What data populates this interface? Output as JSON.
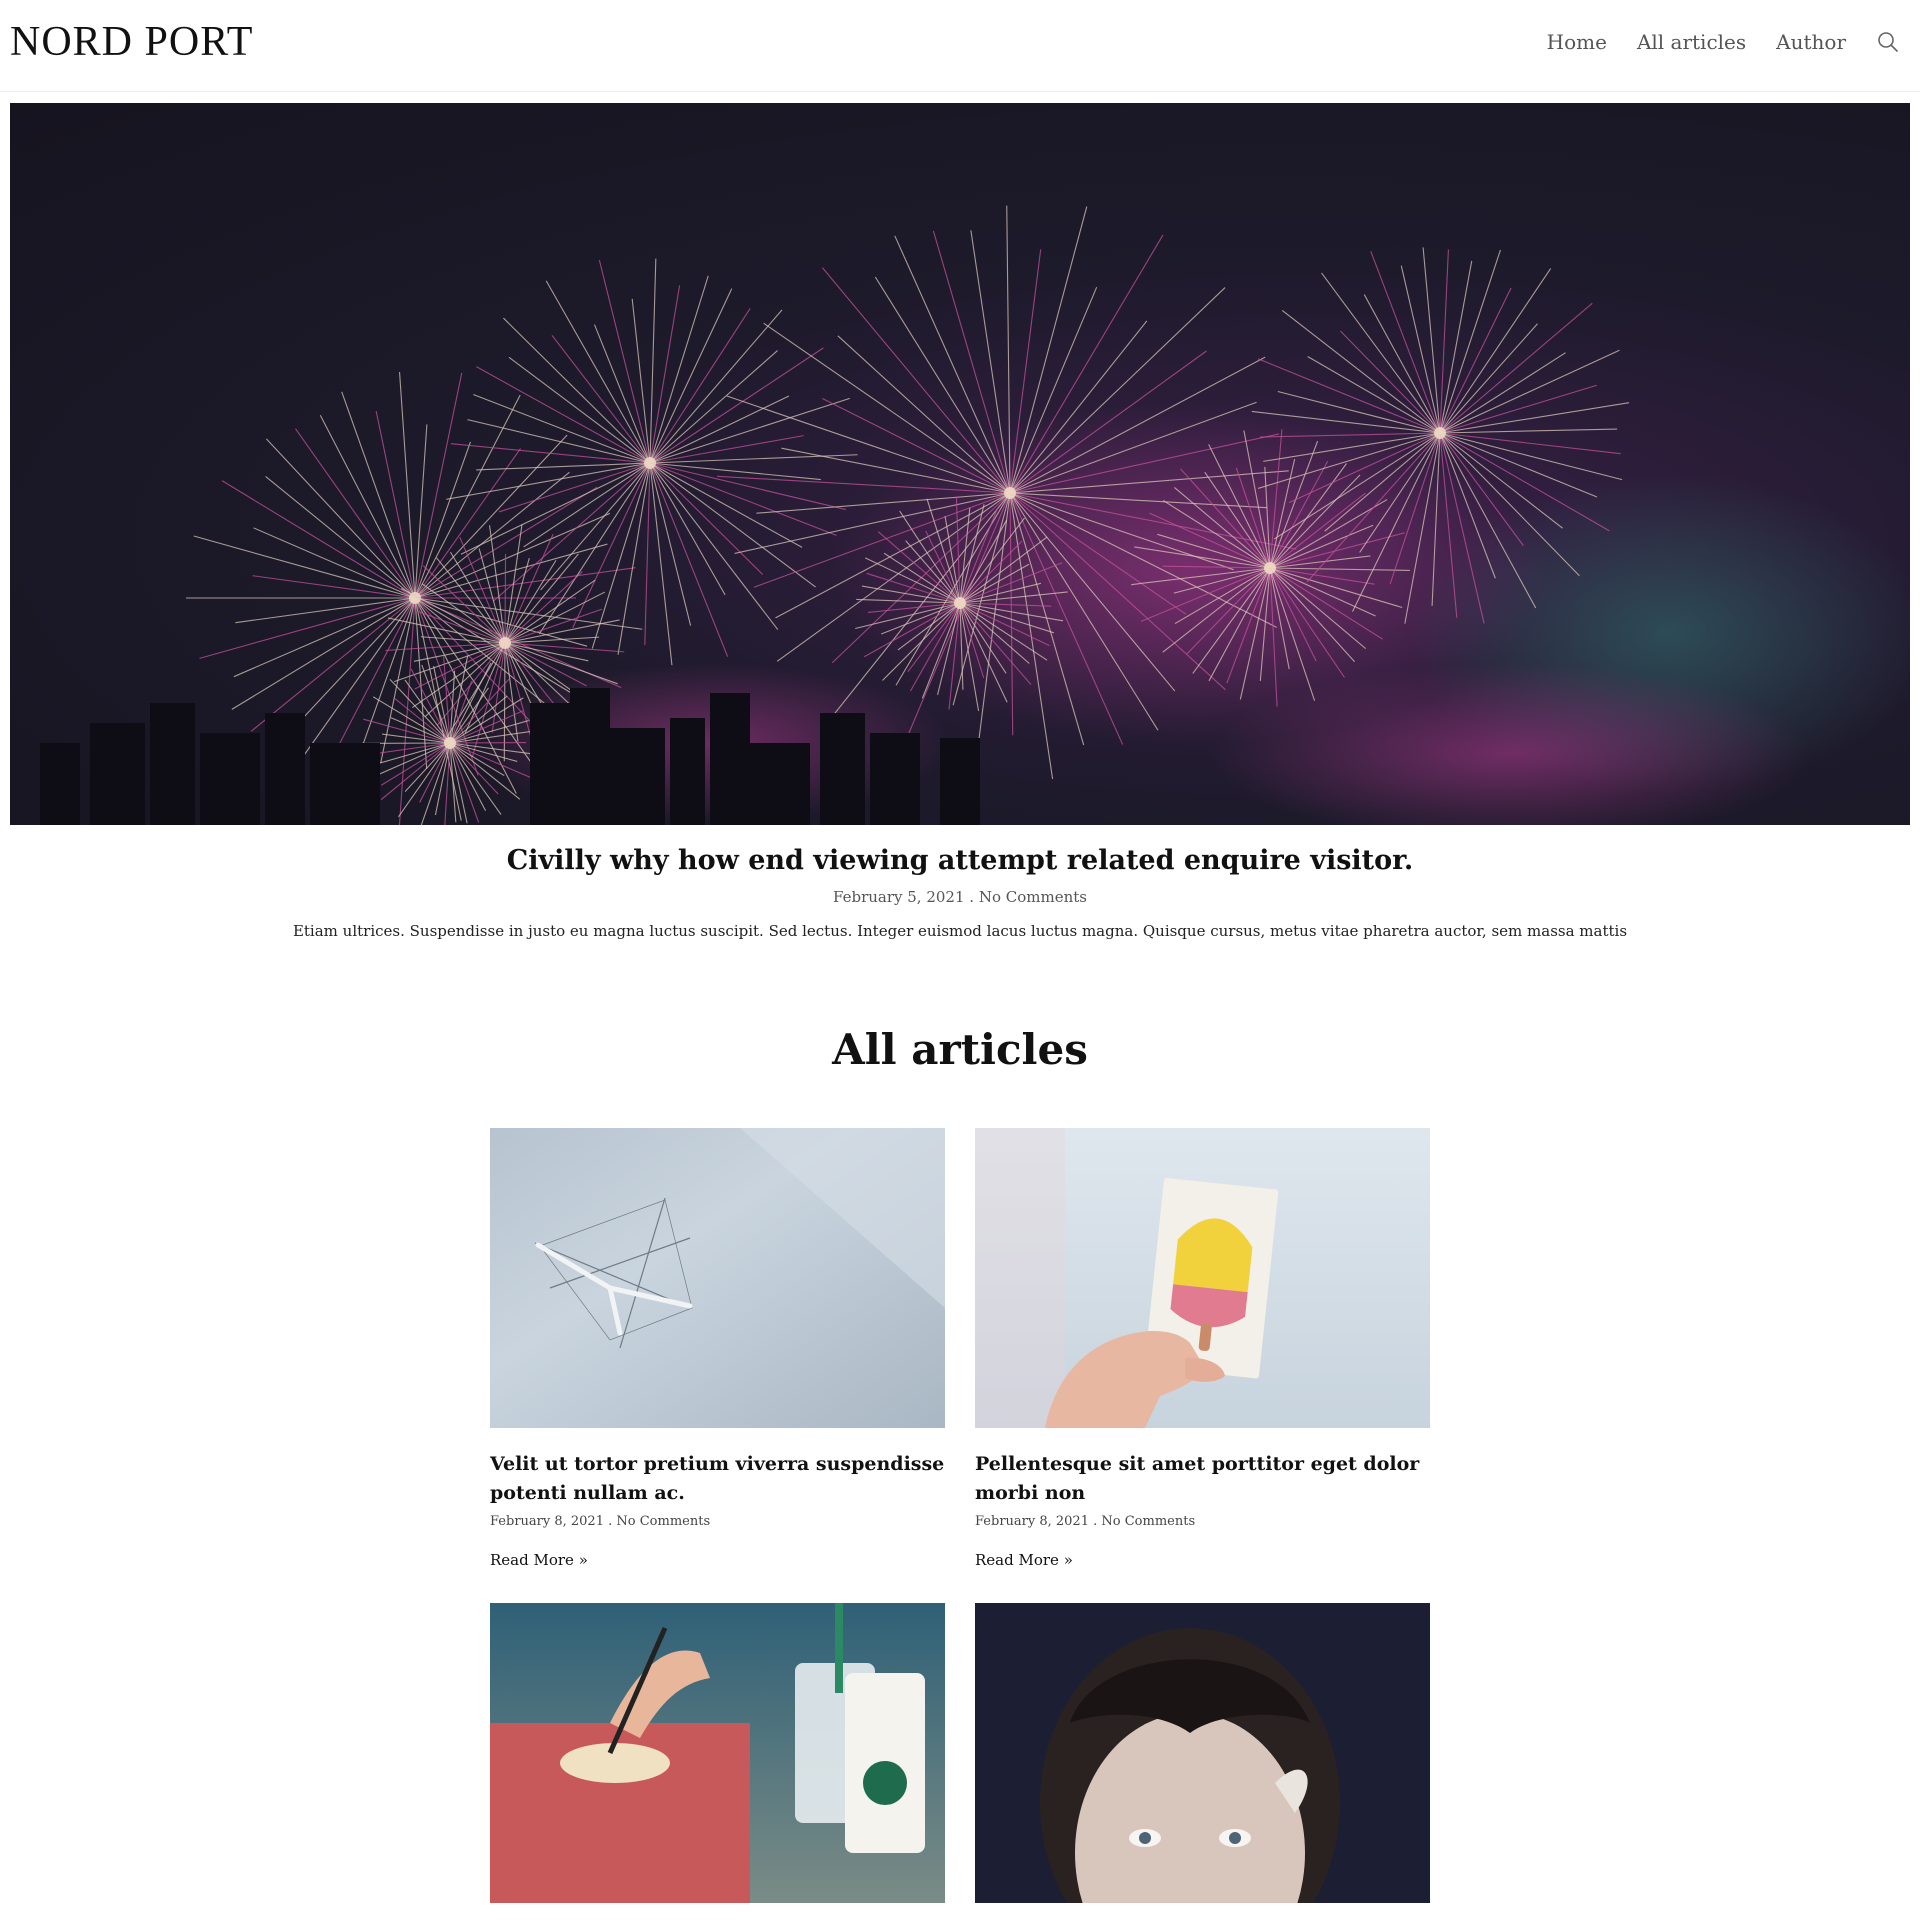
{
  "header": {
    "brand": "NORD PORT",
    "nav": [
      "Home",
      "All articles",
      "Author"
    ],
    "search_icon": "search-icon"
  },
  "featured": {
    "title": "Civilly why how end viewing attempt related enquire visitor.",
    "date": "February 5, 2021",
    "comments": "No Comments",
    "excerpt": "Etiam ultrices. Suspendisse in justo eu magna luctus suscipit. Sed lectus. Integer euismod lacus luctus magna. Quisque cursus, metus vitae pharetra auctor, sem massa mattis"
  },
  "section": {
    "title": "All articles"
  },
  "articles": [
    {
      "title": "Velit ut tortor pretium viverra suspendisse potenti nullam ac.",
      "date": "February 8, 2021",
      "comments": "No Comments",
      "read_more": "Read More »"
    },
    {
      "title": "Pellentesque sit amet porttitor eget dolor morbi non",
      "date": "February 8, 2021",
      "comments": "No Comments",
      "read_more": "Read More »"
    },
    {
      "title": "",
      "date": "",
      "comments": "",
      "read_more": ""
    },
    {
      "title": "",
      "date": "",
      "comments": "",
      "read_more": ""
    }
  ],
  "colors": {
    "text": "#111111",
    "muted": "#555555",
    "hero_bg": "#1d1a2b",
    "firework": "#d9c6b8",
    "firework_pink": "#c3519b"
  }
}
